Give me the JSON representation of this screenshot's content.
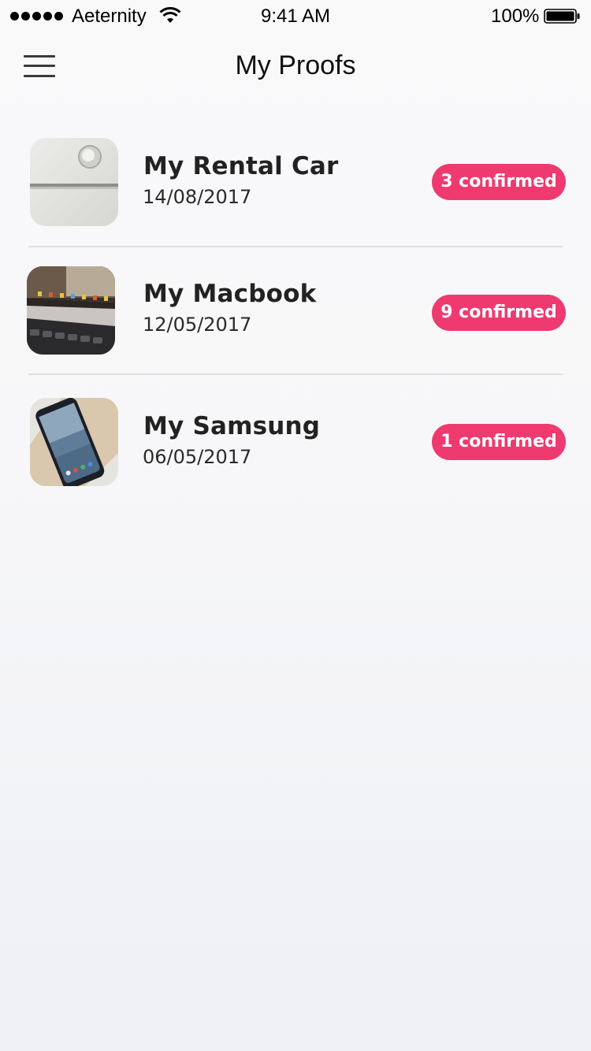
{
  "status_bar": {
    "carrier": "Aeternity",
    "time": "9:41 AM",
    "battery_percent": "100%"
  },
  "header": {
    "title": "My Proofs",
    "menu_icon": "hamburger-menu-icon"
  },
  "proofs": [
    {
      "title": "My Rental Car",
      "date": "14/08/2017",
      "badge": "3 confirmed"
    },
    {
      "title": "My Macbook",
      "date": "12/05/2017",
      "badge": "9 confirmed"
    },
    {
      "title": "My Samsung",
      "date": "06/05/2017",
      "badge": "1 confirmed"
    }
  ],
  "colors": {
    "badge": "#ef3a70",
    "background": "#f7f7f9",
    "divider": "#e0e0e3"
  }
}
